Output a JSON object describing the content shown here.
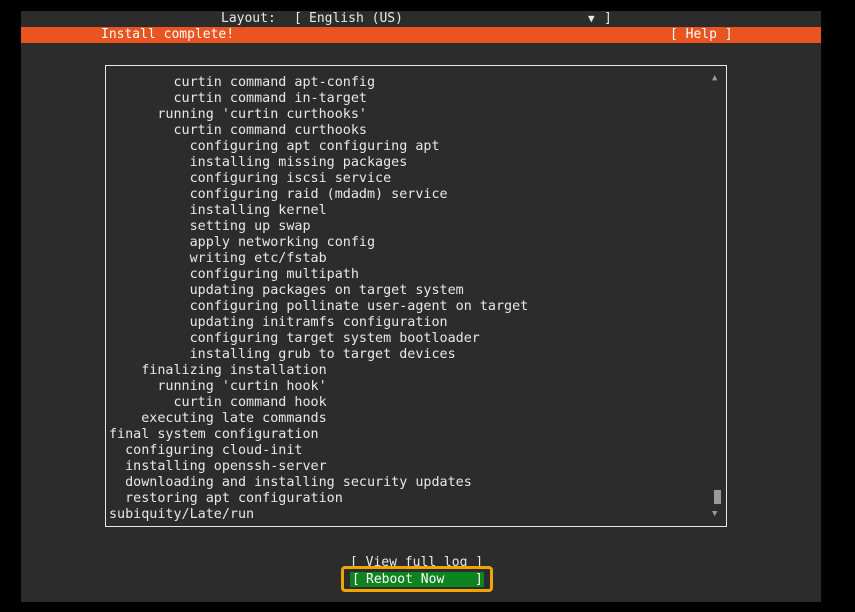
{
  "layout": {
    "label": "Layout:",
    "bracket_left": "[",
    "value": "English (US)",
    "arrow": "▼",
    "bracket_right": "]"
  },
  "header": {
    "title": "Install complete!",
    "help_label": "[ Help ]"
  },
  "log": {
    "lines": [
      "        curtin command apt-config",
      "        curtin command in-target",
      "      running 'curtin curthooks'",
      "        curtin command curthooks",
      "          configuring apt configuring apt",
      "          installing missing packages",
      "          configuring iscsi service",
      "          configuring raid (mdadm) service",
      "          installing kernel",
      "          setting up swap",
      "          apply networking config",
      "          writing etc/fstab",
      "          configuring multipath",
      "          updating packages on target system",
      "          configuring pollinate user-agent on target",
      "          updating initramfs configuration",
      "          configuring target system bootloader",
      "          installing grub to target devices",
      "    finalizing installation",
      "      running 'curtin hook'",
      "        curtin command hook",
      "    executing late commands",
      "final system configuration",
      "  configuring cloud-init",
      "  installing openssh-server",
      "  downloading and installing security updates",
      "  restoring apt configuration",
      "subiquity/Late/run"
    ],
    "scroll_up_icon": "▲",
    "scroll_down_icon": "▼"
  },
  "buttons": {
    "view_full_log": "[ View full log ]",
    "reboot_bracket_left": "[",
    "reboot_now": "Reboot Now",
    "reboot_bracket_right": "]"
  },
  "colors": {
    "header_bg": "#e95420",
    "terminal_bg": "#2c2c2c",
    "reboot_bg": "#0e8420",
    "focus_ring": "#f0a400"
  }
}
